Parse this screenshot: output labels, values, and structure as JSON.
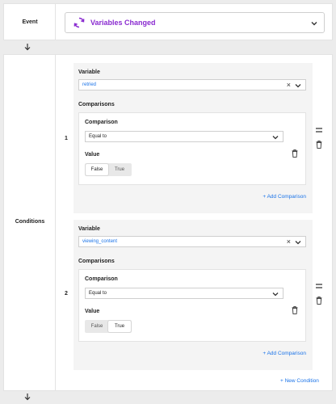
{
  "event": {
    "label": "Event",
    "selected": "Variables Changed",
    "icon": "refresh-icon",
    "accent_color": "#8a2bd0"
  },
  "conditions": {
    "label": "Conditions",
    "items": [
      {
        "index": "1",
        "variable_label": "Variable",
        "variable_value": "retried",
        "comparisons_label": "Comparisons",
        "comparison_label": "Comparison",
        "comparison_value": "Equal to",
        "value_label": "Value",
        "toggle": {
          "false": "False",
          "true": "True",
          "selected": "False"
        },
        "add_comparison": "Add Comparison"
      },
      {
        "index": "2",
        "variable_label": "Variable",
        "variable_value": "viewing_content",
        "comparisons_label": "Comparisons",
        "comparison_label": "Comparison",
        "comparison_value": "Equal to",
        "value_label": "Value",
        "toggle": {
          "false": "False",
          "true": "True",
          "selected": "True"
        },
        "add_comparison": "Add Comparison"
      }
    ],
    "new_condition": "New Condition"
  },
  "colors": {
    "link": "#1a73e8",
    "background": "#ececec"
  }
}
